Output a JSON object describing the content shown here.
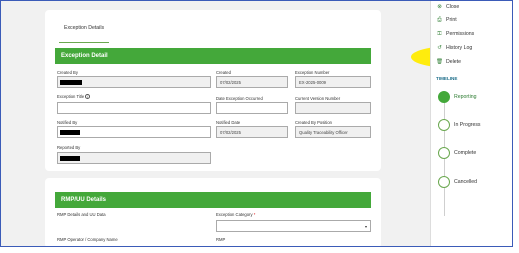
{
  "tab": {
    "label": "Exception Details"
  },
  "exception": {
    "heading": "Exception Detail",
    "created_by_label": "Created By",
    "created_label": "Created",
    "created_value": "07/02/2025",
    "number_label": "Exception Number",
    "number_value": "EX-2025-0009",
    "title_label": "Exception Title",
    "date_occurred_label": "Date Exception Occurred",
    "current_version_label": "Current Version Number",
    "notified_by_label": "Notified By",
    "notified_date_label": "Notified Date",
    "notified_date_value": "07/02/2025",
    "created_by_position_label": "Created By Position",
    "created_by_position_value": "Quality Traceability Officer",
    "reported_by_label": "Reported By"
  },
  "rmp": {
    "heading": "RMP/UU Details",
    "details_label": "RMP Details and UU Data",
    "category_label": "Exception Category",
    "category_required": "*",
    "operator_label": "RMP Operator / Company Name",
    "rmp_label": "RMP"
  },
  "menu": {
    "close": "Close",
    "print": "Print",
    "permissions": "Permissions",
    "history": "History Log",
    "delete": "Delete"
  },
  "timeline": {
    "label": "TIMELINE",
    "steps": [
      "Reporting",
      "In Progress",
      "Complete",
      "Cancelled"
    ]
  },
  "colors": {
    "accent_green": "#44a83a",
    "highlight": "#ffeb00"
  }
}
